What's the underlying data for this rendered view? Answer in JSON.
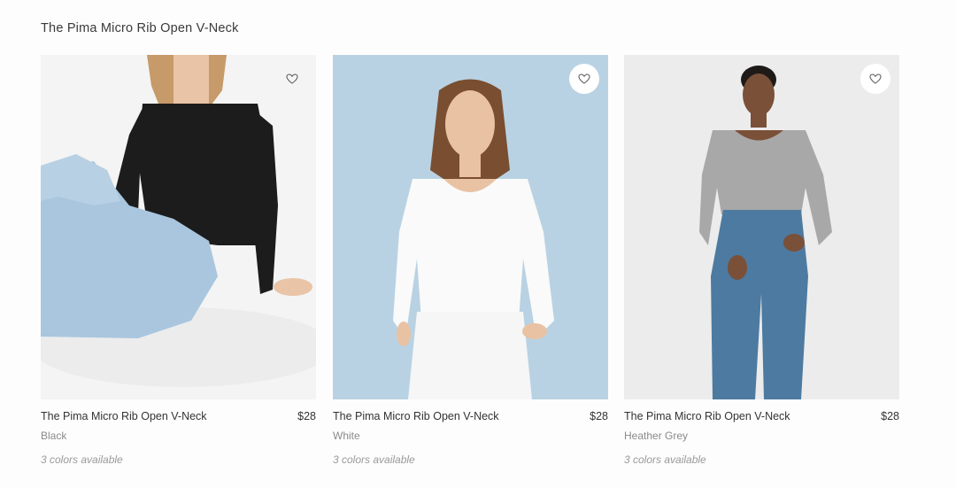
{
  "section": {
    "title": "The Pima Micro Rib Open V-Neck"
  },
  "products": [
    {
      "name": "The Pima Micro Rib Open V-Neck",
      "price": "$28",
      "color": "Black",
      "availability": "3 colors available",
      "icon": "heart-outline-icon",
      "image_bg": "#f4f4f4",
      "shirt_color": "#1c1c1c",
      "pants_color": "#a9c6de"
    },
    {
      "name": "The Pima Micro Rib Open V-Neck",
      "price": "$28",
      "color": "White",
      "availability": "3 colors available",
      "icon": "heart-outline-icon",
      "image_bg": "#b9d2e3",
      "shirt_color": "#fafafa",
      "pants_color": "#f6f6f6"
    },
    {
      "name": "The Pima Micro Rib Open V-Neck",
      "price": "$28",
      "color": "Heather Grey",
      "availability": "3 colors available",
      "icon": "heart-outline-icon",
      "image_bg": "#ececec",
      "shirt_color": "#a8a8a8",
      "pants_color": "#4d7aa0"
    }
  ]
}
